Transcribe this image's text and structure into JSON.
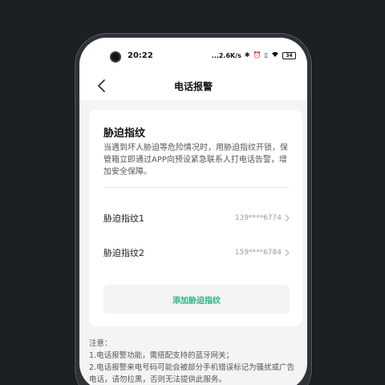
{
  "status_bar": {
    "time": "20:22",
    "net_speed": "...2.6K/s",
    "battery": "34"
  },
  "header": {
    "title": "电话报警"
  },
  "card": {
    "title": "胁迫指纹",
    "description": "当遇到坏人胁迫等危险情况时，用胁迫指纹开锁，保管箱立即通过APP向预设紧急联系人打电话告警，增加安全保障。",
    "items": [
      {
        "label": "胁迫指纹1",
        "phone": "139****6774"
      },
      {
        "label": "胁迫指纹2",
        "phone": "159****6784"
      }
    ],
    "add_button": "添加胁迫指纹"
  },
  "notes": {
    "heading": "注意：",
    "lines": [
      "1.电话报警功能，需搭配支持的蓝牙网关；",
      "2.电话报警来电号码可能会被部分手机错误标记为骚扰或广告电话，请勿拉黑，否则无法提供此服务。"
    ]
  },
  "colors": {
    "accent": "#2cb388",
    "background": "#1c1f23"
  }
}
